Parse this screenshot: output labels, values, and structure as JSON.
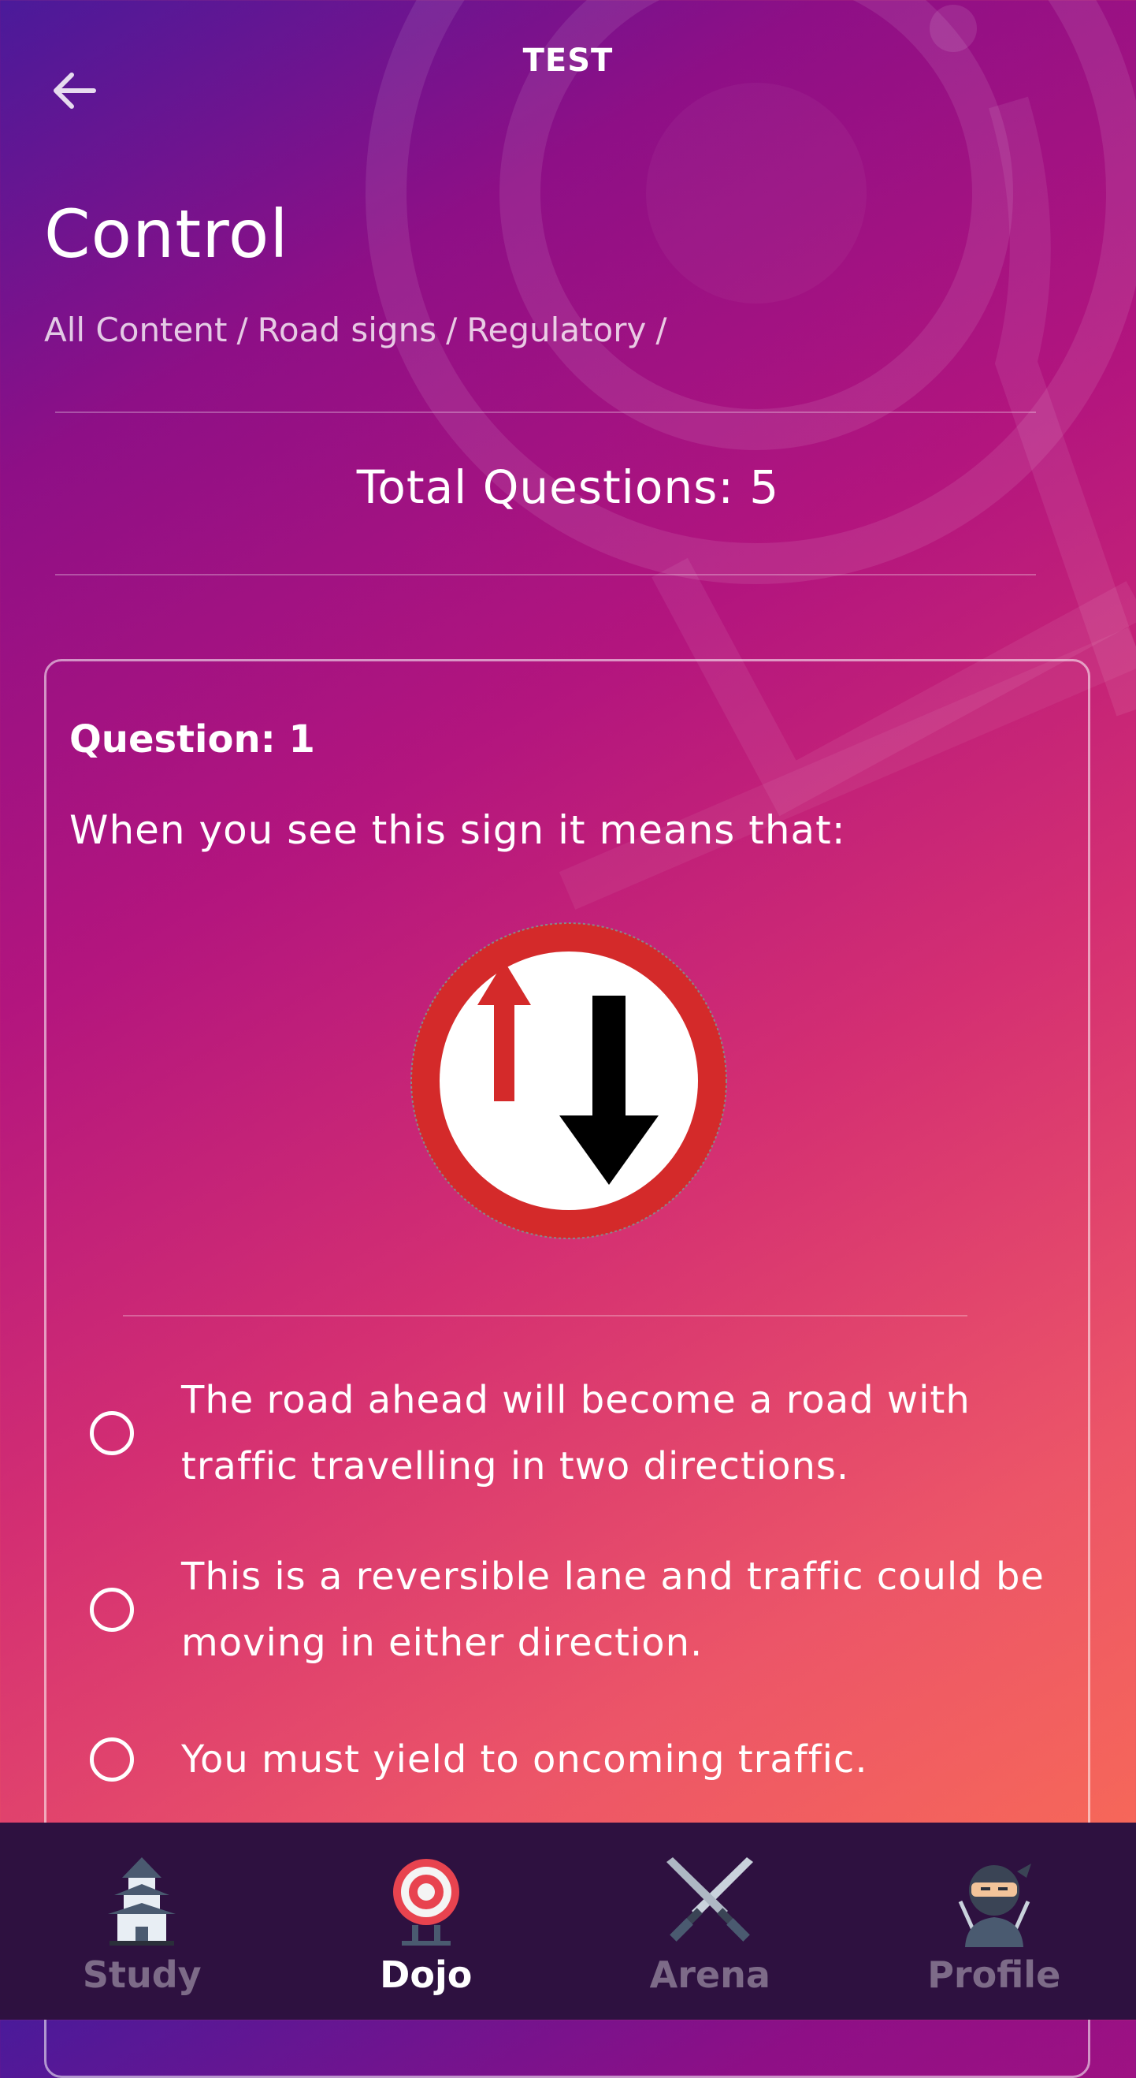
{
  "header": {
    "app_title": "TEST",
    "back_icon": "arrow-left-icon"
  },
  "page": {
    "title": "Control",
    "breadcrumb": [
      "All Content",
      "Road signs",
      "Regulatory"
    ],
    "breadcrumb_separator": "/"
  },
  "summary": {
    "total_questions_label": "Total Questions: 5"
  },
  "question": {
    "number_label": "Question: 1",
    "text": "When you see this sign it means that:",
    "sign_icon": "yield-to-oncoming-traffic-sign-icon",
    "options": [
      {
        "label": "The road ahead will become a road with traffic travelling in two directions.",
        "selected": false
      },
      {
        "label": "This is a reversible lane and traffic could be moving in either direction.",
        "selected": false
      },
      {
        "label": "You must yield to oncoming traffic.",
        "selected": false
      }
    ]
  },
  "bottom_nav": {
    "active": "Dojo",
    "items": [
      {
        "label": "Study",
        "icon": "pagoda-icon"
      },
      {
        "label": "Dojo",
        "icon": "target-icon"
      },
      {
        "label": "Arena",
        "icon": "crossed-swords-icon"
      },
      {
        "label": "Profile",
        "icon": "ninja-icon"
      }
    ]
  },
  "colors": {
    "gradient_start": "#4a1a9a",
    "gradient_mid": "#b3157e",
    "gradient_end": "#fb7052",
    "nav_background": "#2e1140",
    "sign_red": "#d42a2a"
  }
}
